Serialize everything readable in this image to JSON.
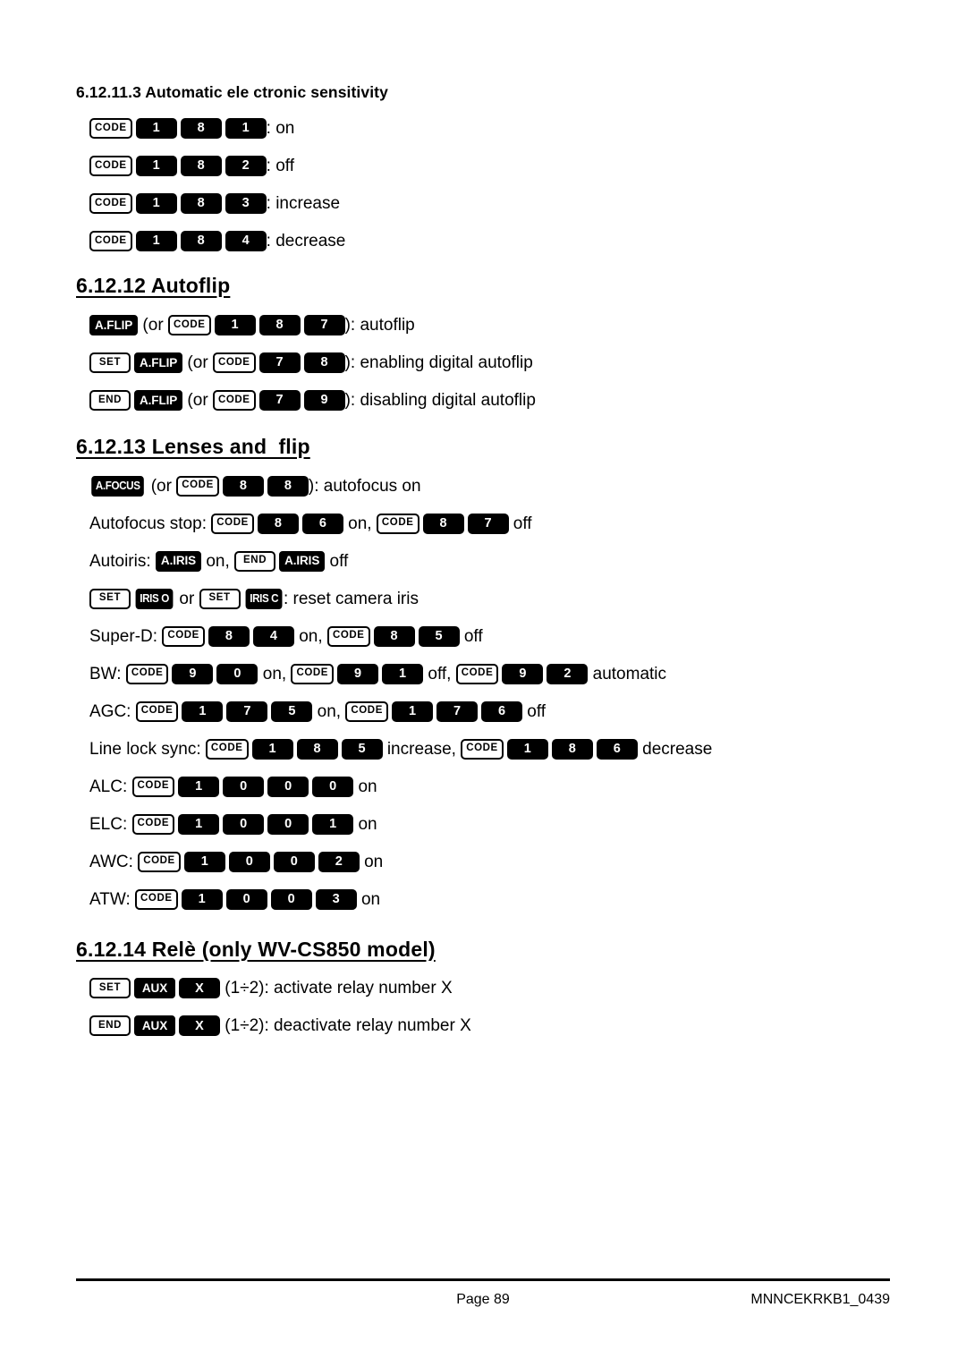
{
  "document": {
    "sub_heading": "6.12.11.3 Automatic ele ctronic sensitivity",
    "sections": [
      {
        "heading": "6.12.12 Autoflip"
      },
      {
        "heading": "6.12.13 Lenses and  flip"
      },
      {
        "heading": "6.12.14 Relè (only WV-CS850 model)"
      }
    ]
  },
  "keys": {
    "code": "CODE",
    "set": "SET",
    "end": "END",
    "aflip": "A.FLIP",
    "afocus": "A.FOCUS",
    "airis": "A.IRIS",
    "iris_o": "IRIS O",
    "iris_c": "IRIS C",
    "aux": "AUX",
    "x": "X",
    "d0": "0",
    "d1": "1",
    "d2": "2",
    "d3": "3",
    "d4": "4",
    "d5": "5",
    "d6": "6",
    "d7": "7",
    "d8": "8",
    "d9": "9"
  },
  "sensitivity_rows": [
    {
      "digits": [
        "1",
        "8",
        "1"
      ],
      "text": ": on"
    },
    {
      "digits": [
        "1",
        "8",
        "2"
      ],
      "text": ": off"
    },
    {
      "digits": [
        "1",
        "8",
        "3"
      ],
      "text": ": increase"
    },
    {
      "digits": [
        "1",
        "8",
        "4"
      ],
      "text": ": decrease"
    }
  ],
  "autoflip_rows": [
    {
      "prefix_keys": [
        "A.FLIP"
      ],
      "or_open": " (or ",
      "digits": [
        "1",
        "8",
        "7"
      ],
      "suffix": "): autoflip"
    },
    {
      "prefix_keys": [
        "SET",
        "A.FLIP"
      ],
      "or_open": " (or ",
      "digits": [
        "7",
        "8"
      ],
      "suffix": "): enabling digital autoflip"
    },
    {
      "prefix_keys": [
        "END",
        "A.FLIP"
      ],
      "or_open": " (or ",
      "digits": [
        "7",
        "9"
      ],
      "suffix": "): disabling digital autoflip"
    }
  ],
  "lenses": {
    "autofocus_on": {
      "key": "A.FOCUS",
      "or_open": " (or ",
      "digits": [
        "8",
        "8"
      ],
      "suffix": "): autofocus on"
    },
    "autofocus_stop": {
      "label": "Autofocus stop: ",
      "digits_a": [
        "8",
        "6"
      ],
      "mid": " on, ",
      "digits_b": [
        "8",
        "7"
      ],
      "end": " off"
    },
    "autoiris": {
      "label": "Autoiris: ",
      "key_on": "A.IRIS",
      "mid": " on, ",
      "key_end": "END",
      "key_off": "A.IRIS",
      "end": " off"
    },
    "iris_reset": {
      "set_a": "SET",
      "iris_o": "IRIS O",
      "mid": " or ",
      "set_b": "SET",
      "iris_c": "IRIS C",
      "end": ": reset camera iris"
    },
    "super_d": {
      "label": "Super-D: ",
      "digits_a": [
        "8",
        "4"
      ],
      "mid": " on, ",
      "digits_b": [
        "8",
        "5"
      ],
      "end": " off"
    },
    "bw": {
      "label": "BW: ",
      "digits_a": [
        "9",
        "0"
      ],
      "mid_a": " on, ",
      "digits_b": [
        "9",
        "1"
      ],
      "mid_b": " off, ",
      "digits_c": [
        "9",
        "2"
      ],
      "end": " automatic"
    },
    "agc": {
      "label": "AGC: ",
      "digits_a": [
        "1",
        "7",
        "5"
      ],
      "mid": " on, ",
      "digits_b": [
        "1",
        "7",
        "6"
      ],
      "end": " off"
    },
    "line_lock": {
      "label": "Line lock sync: ",
      "digits_a": [
        "1",
        "8",
        "5"
      ],
      "mid": " increase, ",
      "digits_b": [
        "1",
        "8",
        "6"
      ],
      "end": " decrease"
    },
    "alc": {
      "label": "ALC: ",
      "digits": [
        "1",
        "0",
        "0",
        "0"
      ],
      "end": " on"
    },
    "elc": {
      "label": "ELC: ",
      "digits": [
        "1",
        "0",
        "0",
        "1"
      ],
      "end": " on"
    },
    "awc": {
      "label": "AWC: ",
      "digits": [
        "1",
        "0",
        "0",
        "2"
      ],
      "end": " on"
    },
    "atw": {
      "label": "ATW: ",
      "digits": [
        "1",
        "0",
        "0",
        "3"
      ],
      "end": " on"
    }
  },
  "rele_rows": [
    {
      "first": "SET",
      "aux": "AUX",
      "x": "X",
      "text": " (1÷2): activate relay number X"
    },
    {
      "first": "END",
      "aux": "AUX",
      "x": "X",
      "text": " (1÷2): deactivate relay number X"
    }
  ],
  "footer": {
    "page": "Page 89",
    "code": "MNNCEKRKB1_0439"
  }
}
